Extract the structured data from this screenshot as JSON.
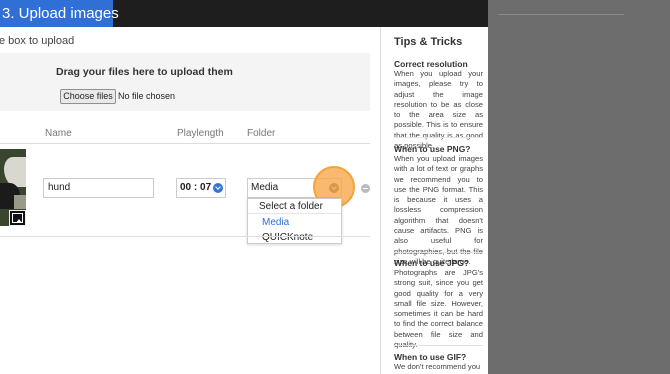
{
  "header": {
    "step_label": "3. Upload images"
  },
  "upload": {
    "instruction": "e box to upload",
    "drop_text": "Drag your files here to upload them",
    "choose_button": "Choose files",
    "no_file": "No file chosen"
  },
  "table": {
    "columns": {
      "name": "Name",
      "playlength": "Playlength",
      "folder": "Folder"
    },
    "row": {
      "name": "hund",
      "playlength": "00 : 07",
      "folder": "Media"
    }
  },
  "folder_dropdown": {
    "header": "Select a folder",
    "options": [
      "Media",
      "QUICKnote"
    ],
    "selected": "Media"
  },
  "tips": {
    "title": "Tips & Tricks",
    "sections": [
      {
        "heading": "Correct resolution",
        "body": "When you upload your images, please try to adjust the image resolution to be as close to the area size as possible. This is to ensure that the quality is as good as possible."
      },
      {
        "heading": "When to use PNG?",
        "body": "When you upload images with a lot of text or graphs we recommend you to use the PNG format. This is because it uses a lossless compression algorithm that doesn't cause artifacts. PNG is also useful for photographies, but the file size will be quite large."
      },
      {
        "heading": "When to use JPG?",
        "body": "Photographs are JPG's strong suit, since you get good quality for a very small file size. However, sometimes it can be hard to find the correct balance between file size and quality."
      },
      {
        "heading": "When to use GIF?",
        "body": "We don't recommend you"
      }
    ]
  },
  "colors": {
    "accent": "#2f6fd6",
    "highlight": "#f4a23a",
    "topbar": "#1e1e1e"
  },
  "icons": {
    "image": "image-icon",
    "time_select": "chevron-down-icon",
    "folder_select": "chevron-down-icon",
    "remove": "minus-circle-icon"
  }
}
